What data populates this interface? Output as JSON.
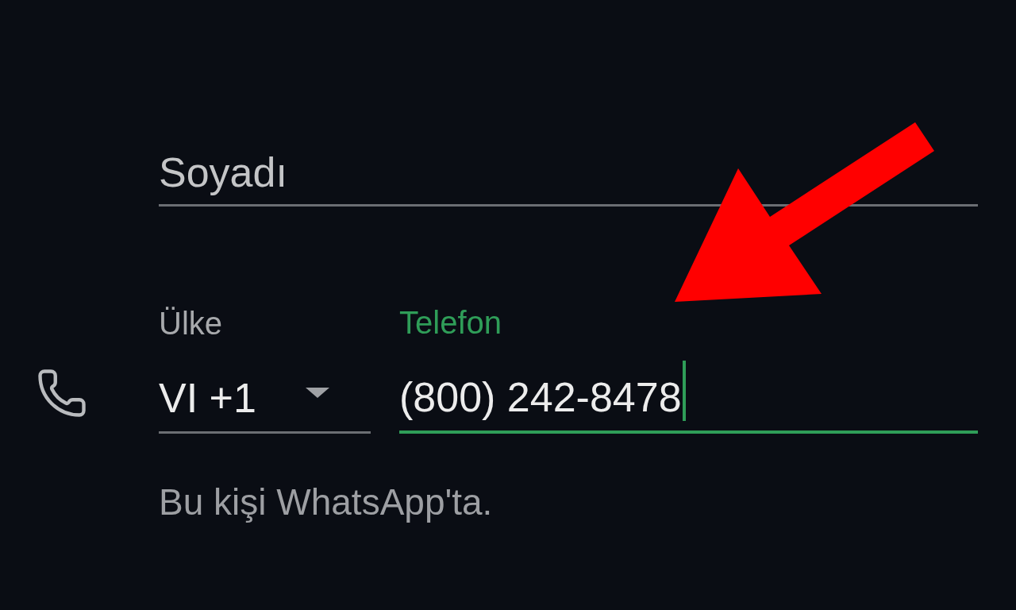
{
  "surname": {
    "placeholder": "Soyadı",
    "focused": false
  },
  "phone_row": {
    "country": {
      "label": "Ülke",
      "value": "VI +1",
      "focused": false
    },
    "phone": {
      "label": "Telefon",
      "value": "(800) 242-8478",
      "focused": true
    }
  },
  "helper_text": "Bu kişi WhatsApp'ta.",
  "annotations": [
    {
      "kind": "arrow"
    }
  ]
}
